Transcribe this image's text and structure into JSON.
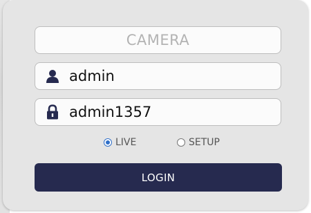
{
  "form": {
    "title_field": "CAMERA",
    "username": {
      "value": "admin",
      "icon": "user-icon"
    },
    "password": {
      "value": "admin1357",
      "icon": "lock-icon"
    },
    "mode_options": [
      {
        "label": "LIVE",
        "selected": true
      },
      {
        "label": "SETUP",
        "selected": false
      }
    ],
    "login_label": "LOGIN"
  },
  "colors": {
    "panel_bg": "#e5e5e5",
    "button_bg": "#262a4f",
    "icon_color": "#262a4f",
    "radio_accent": "#2f6fc8"
  }
}
